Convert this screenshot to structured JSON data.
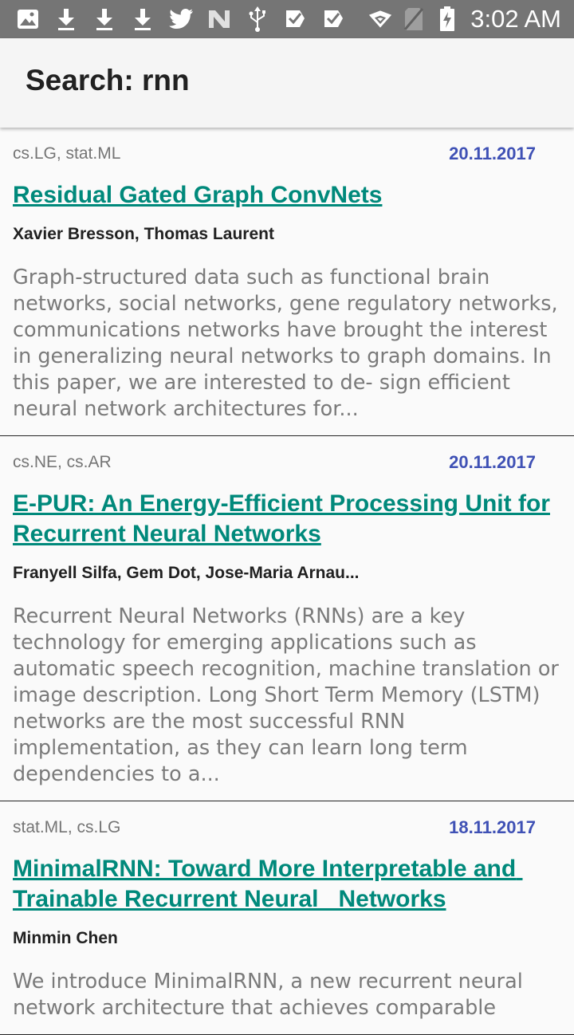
{
  "status_bar": {
    "time": "3:02 AM",
    "left_icons": [
      "image-icon",
      "download-icon",
      "download-icon",
      "download-icon",
      "twitter-icon",
      "n-app-icon",
      "usb-icon",
      "checkbox-app-icon",
      "checkbox-app-icon"
    ],
    "right_icons": [
      "wifi-icon",
      "no-sim-icon",
      "battery-charging-icon"
    ]
  },
  "app_bar": {
    "title": "Search: rnn"
  },
  "papers": [
    {
      "categories": "cs.LG, stat.ML",
      "date": "20.11.2017",
      "title": "Residual Gated Graph ConvNets",
      "authors": "Xavier Bresson, Thomas Laurent",
      "abstract": "Graph-structured data such as functional brain networks, social networks, gene regulatory networks, communications networks have brought the interest in generalizing neural networks to graph domains. In this paper, we are interested to de- sign efficient neural network architectures for..."
    },
    {
      "categories": "cs.NE, cs.AR",
      "date": "20.11.2017",
      "title": "E-PUR: An Energy-Efficient Processing Unit for Recurrent Neural Networks",
      "authors": "Franyell Silfa, Gem Dot, Jose-Maria Arnau...",
      "abstract": "Recurrent Neural Networks (RNNs) are a key technology for emerging applications such as automatic speech recognition, machine translation or image description. Long Short Term Memory (LSTM) networks are the most successful RNN implementation, as they can learn long term dependencies to a..."
    },
    {
      "categories": "stat.ML, cs.LG",
      "date": "18.11.2017",
      "title": "MinimalRNN: Toward More Interpretable and Trainable Recurrent Neural   Networks",
      "authors": "Minmin Chen",
      "abstract": "We introduce MinimalRNN, a new recurrent neural network architecture that achieves comparable"
    }
  ]
}
